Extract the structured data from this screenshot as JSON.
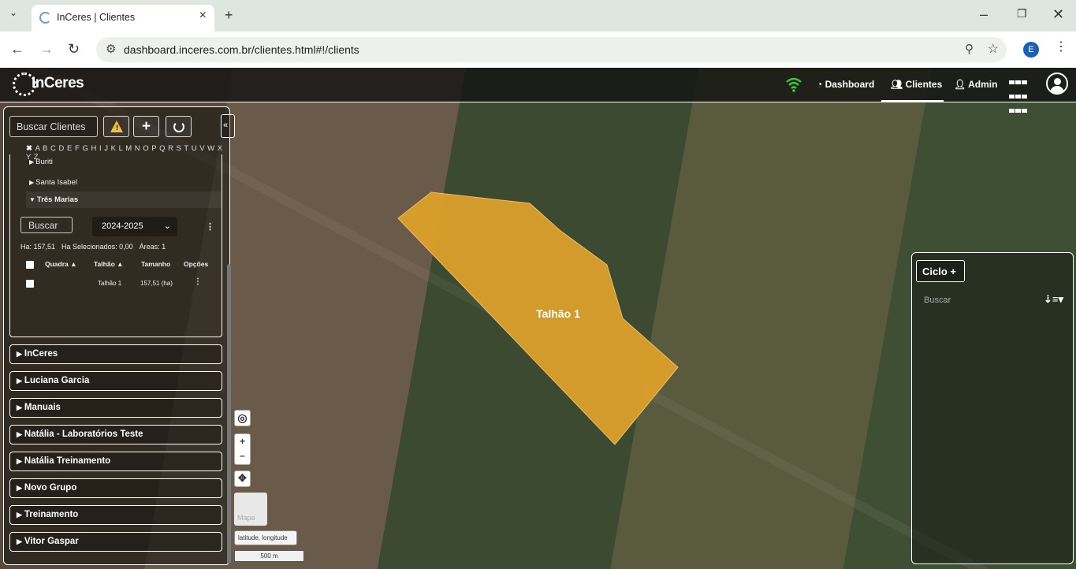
{
  "browser": {
    "tab_title": "InCeres | Clientes",
    "url": "dashboard.inceres.com.br/clientes.html#!/clients",
    "profile_initial": "E"
  },
  "navbar": {
    "logo_text": "InCeres",
    "dashboard": "Dashboard",
    "clientes": "Clientes",
    "admin": "Admin"
  },
  "sidebar": {
    "search_placeholder": "Buscar Clientes",
    "alphabet": "A B C D E F G H I J K L M N O P Q R S T U V W X Y Z",
    "tree": [
      "Buriti",
      "Santa Isabel",
      "Três Marias"
    ],
    "farm": {
      "search_placeholder": "Buscar",
      "season": "2024-2025",
      "ha": "Ha: 157,51",
      "ha_selected": "Ha Selecionados: 0,00",
      "areas": "Áreas: 1",
      "columns": [
        "Quadra",
        "Talhão",
        "Tamanho",
        "Opções"
      ],
      "rows": [
        {
          "quadra": "",
          "talhao": "Talhão 1",
          "tamanho": "157,51 (ha)"
        }
      ]
    },
    "groups": [
      "InCeres",
      "Luciana Garcia",
      "Manuais",
      "Natália - Laboratórios Teste",
      "Natália Treinamento",
      "Novo Grupo",
      "Treinamento",
      "Vitor Gaspar"
    ]
  },
  "map": {
    "field_label": "Talhão 1",
    "field_color": "#e0a22a",
    "basemap_label": "Mapa",
    "coords_label": "latitude, longitude",
    "scale_label": "500 m"
  },
  "right_panel": {
    "ciclo_label": "Ciclo",
    "search_placeholder": "Buscar"
  }
}
